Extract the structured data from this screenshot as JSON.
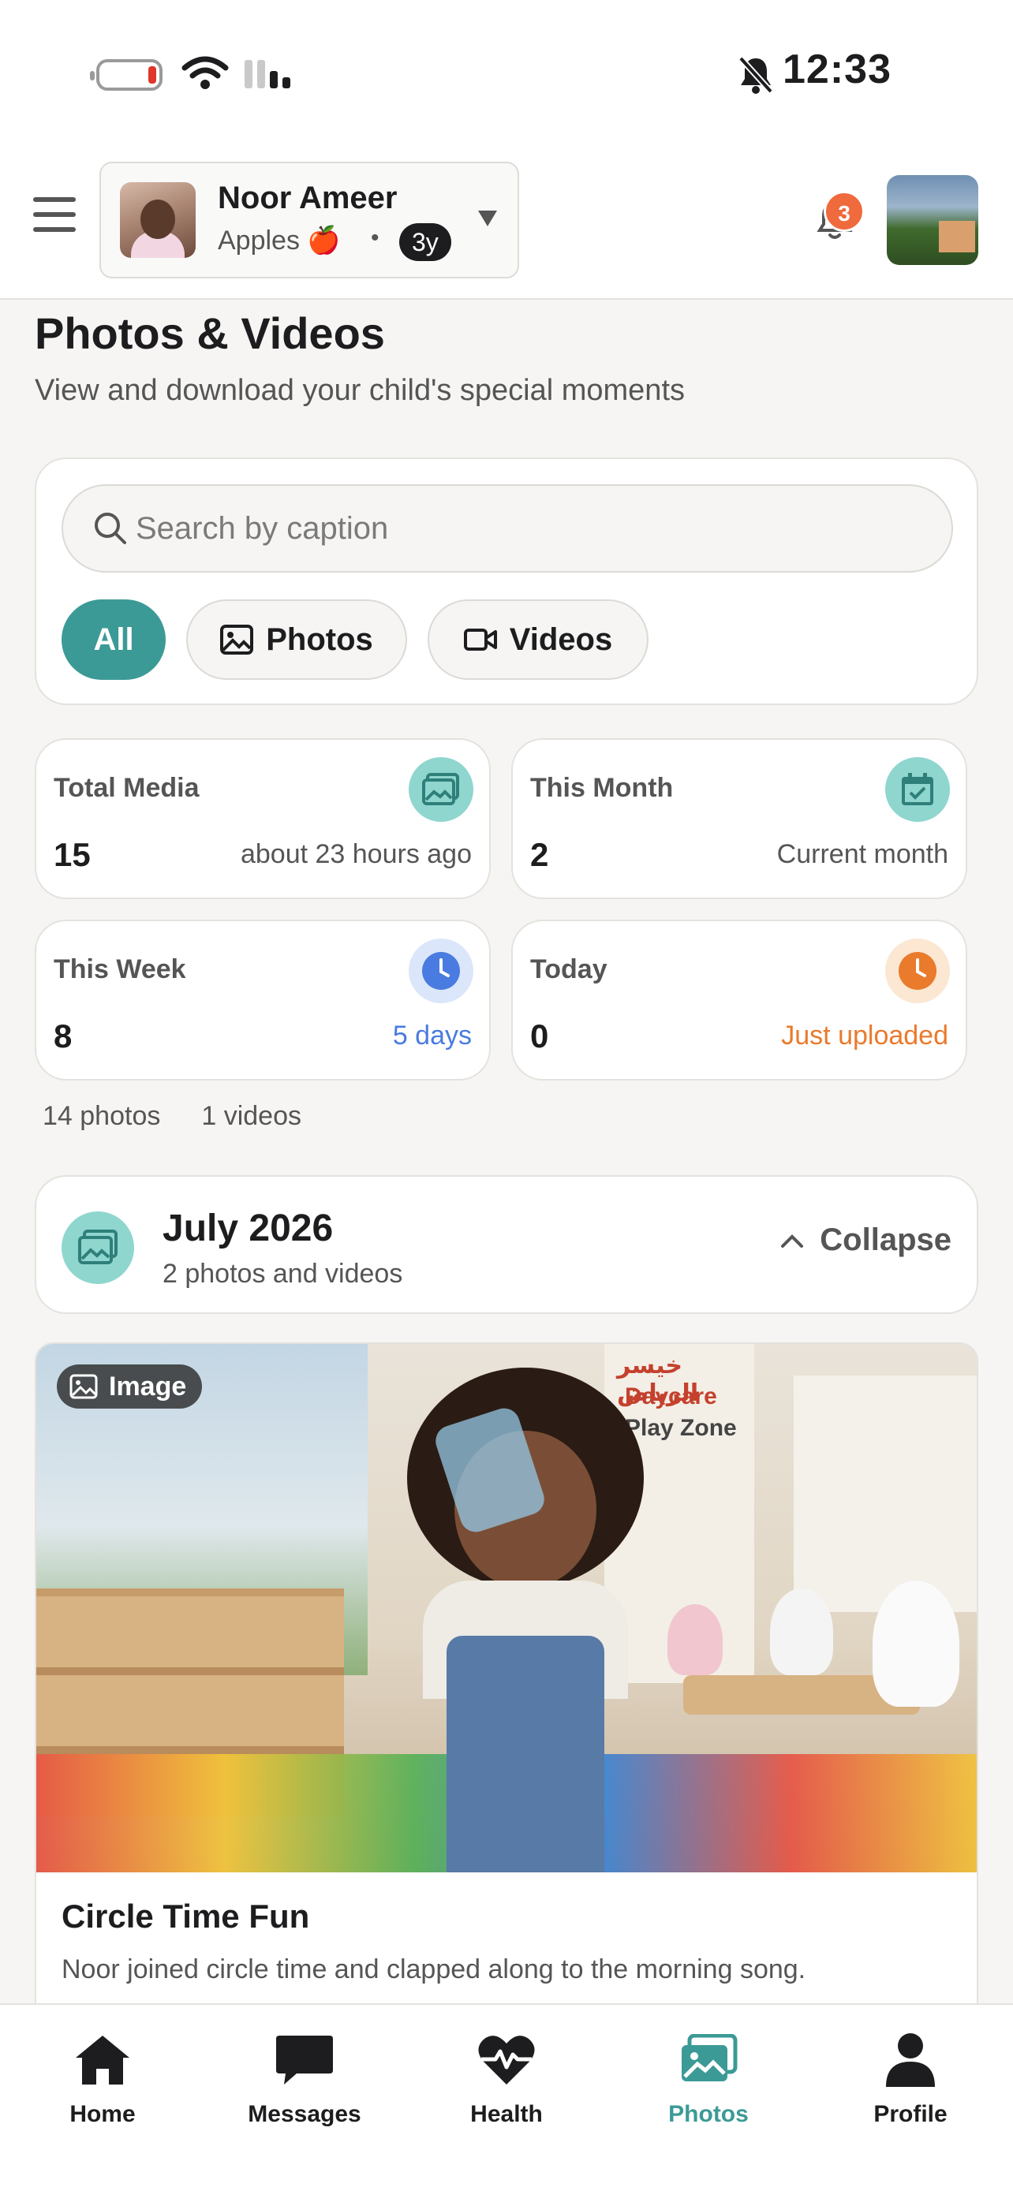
{
  "status_bar": {
    "time": "12:33"
  },
  "header": {
    "child_name": "Noor Ameer",
    "class_name": "Apples 🍎",
    "separator": "•",
    "age": "3y",
    "notification_count": "3"
  },
  "page": {
    "title": "Photos & Videos",
    "subtitle": "View and download your child's special moments"
  },
  "filters": {
    "search_placeholder": "Search by caption",
    "search_value": "",
    "tabs": [
      {
        "label": "All",
        "active": true
      },
      {
        "label": "Photos",
        "active": false
      },
      {
        "label": "Videos",
        "active": false
      }
    ]
  },
  "stats": [
    {
      "label": "Total Media",
      "value": "15",
      "note": "about 23 hours ago",
      "icon": "image-icon",
      "icon_bg": "#8fd6cf",
      "icon_color": "#2f7f7a",
      "note_color": "#555555"
    },
    {
      "label": "This Month",
      "value": "2",
      "note": "Current month",
      "icon": "calendar-check-icon",
      "icon_bg": "#8fd6cf",
      "icon_color": "#2f7f7a",
      "note_color": "#555555"
    },
    {
      "label": "This Week",
      "value": "8",
      "note": "5 days",
      "icon": "clock-icon",
      "icon_bg": "#dbe6fb",
      "icon_color": "#4a7be0",
      "note_color": "#4a7be0"
    },
    {
      "label": "Today",
      "value": "0",
      "note": "Just uploaded",
      "icon": "clock-icon",
      "icon_bg": "#fbe7d2",
      "icon_color": "#ea7a2c",
      "note_color": "#ea7a2c"
    }
  ],
  "counts": {
    "photos": "14 photos",
    "videos": "1 videos"
  },
  "group": {
    "title": "July 2026",
    "subtitle": "2 photos and videos",
    "collapse_label": "Collapse"
  },
  "media": [
    {
      "type_label": "Image",
      "title": "Circle Time Fun",
      "caption": "Noor joined circle time and clapped along to the morning song.",
      "banner_lines": [
        "خيسر الرياض",
        "Daycare",
        "Play Zone"
      ]
    }
  ],
  "nav": [
    {
      "label": "Home",
      "icon": "home-icon",
      "active": false
    },
    {
      "label": "Messages",
      "icon": "chat-icon",
      "active": false
    },
    {
      "label": "Health",
      "icon": "heart-pulse-icon",
      "active": false
    },
    {
      "label": "Photos",
      "icon": "photos-icon",
      "active": true
    },
    {
      "label": "Profile",
      "icon": "person-icon",
      "active": false
    }
  ],
  "colors": {
    "accent": "#3c9a96",
    "notification": "#ef6a3c",
    "background": "#f6f5f3"
  }
}
